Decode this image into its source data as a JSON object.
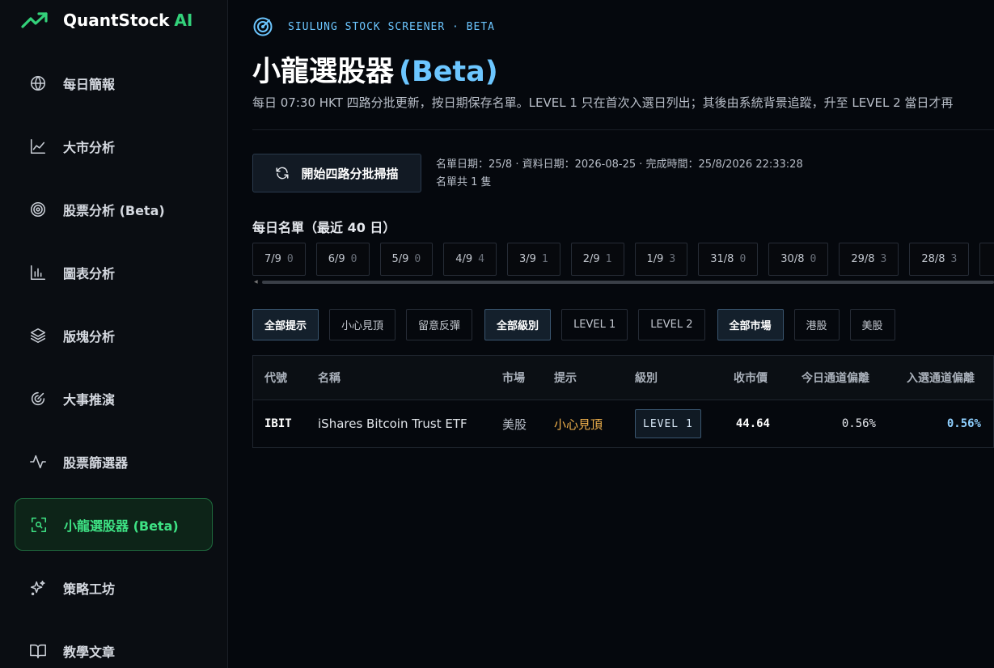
{
  "brand": {
    "name": "QuantStock",
    "suffix": "AI",
    "accent": "#33d17a"
  },
  "sidebar": {
    "items": [
      {
        "label": "每日簡報",
        "icon": "globe-icon"
      },
      {
        "label": "大市分析",
        "icon": "line-chart-icon"
      },
      {
        "label": "股票分析 (Beta)",
        "icon": "target-icon"
      },
      {
        "label": "圖表分析",
        "icon": "bar-chart-icon"
      },
      {
        "label": "版塊分析",
        "icon": "layers-icon"
      },
      {
        "label": "大事推演",
        "icon": "radar-icon"
      },
      {
        "label": "股票篩選器",
        "icon": "activity-icon"
      },
      {
        "label": "小龍選股器 (Beta)",
        "icon": "scan-icon",
        "active": true
      },
      {
        "label": "策略工坊",
        "icon": "sparkles-icon"
      },
      {
        "label": "教學文章",
        "icon": "book-icon"
      }
    ]
  },
  "header": {
    "eyebrow": "SIULUNG STOCK SCREENER · BETA",
    "title": "小龍選股器",
    "title_beta": "(Beta)",
    "subtitle": "每日 07:30 HKT 四路分批更新，按日期保存名單。LEVEL 1 只在首次入選日列出；其後由系統背景追蹤，升至 LEVEL 2 當日才再"
  },
  "scan": {
    "button_label": "開始四路分批掃描",
    "meta_line1": "名單日期：25/8 · 資料日期：2026-08-25 · 完成時間：25/8/2026 22:33:28",
    "meta_line2": "名單共 1 隻"
  },
  "daily_list": {
    "title": "每日名單（最近 40 日）",
    "dates": [
      {
        "date": "7/9",
        "count": "0"
      },
      {
        "date": "6/9",
        "count": "0"
      },
      {
        "date": "5/9",
        "count": "0"
      },
      {
        "date": "4/9",
        "count": "4"
      },
      {
        "date": "3/9",
        "count": "1"
      },
      {
        "date": "2/9",
        "count": "1"
      },
      {
        "date": "1/9",
        "count": "3"
      },
      {
        "date": "31/8",
        "count": "0"
      },
      {
        "date": "30/8",
        "count": "0"
      },
      {
        "date": "29/8",
        "count": "3"
      },
      {
        "date": "28/8",
        "count": "3"
      }
    ]
  },
  "filters": {
    "hints": [
      "全部提示",
      "小心見頂",
      "留意反彈"
    ],
    "levels": [
      "全部級別",
      "LEVEL 1",
      "LEVEL 2"
    ],
    "markets": [
      "全部市場",
      "港股",
      "美股"
    ]
  },
  "table": {
    "headers": {
      "code": "代號",
      "name": "名稱",
      "market": "市場",
      "hint": "提示",
      "level": "級別",
      "price": "收市價",
      "today_dev": "今日通道偏離",
      "entry_dev": "入選通道偏離"
    },
    "rows": [
      {
        "code": "IBIT",
        "name": "iShares Bitcoin Trust ETF",
        "market": "美股",
        "hint": "小心見頂",
        "level": "LEVEL 1",
        "price": "44.64",
        "today_dev": "0.56%",
        "entry_dev": "0.56%"
      }
    ]
  }
}
